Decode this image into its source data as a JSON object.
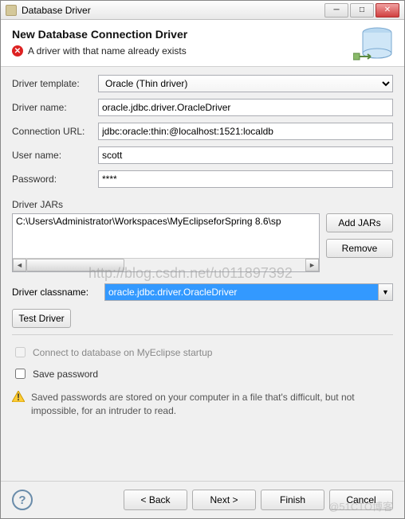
{
  "window": {
    "title": "Database Driver"
  },
  "header": {
    "title": "New Database Connection Driver",
    "error_message": "A driver with that name already exists"
  },
  "form": {
    "template_label": "Driver template:",
    "template_value": "Oracle (Thin driver)",
    "name_label": "Driver name:",
    "name_value": "oracle.jdbc.driver.OracleDriver",
    "url_label": "Connection URL:",
    "url_value": "jdbc:oracle:thin:@localhost:1521:localdb",
    "user_label": "User name:",
    "user_value": "scott",
    "password_label": "Password:",
    "password_value": "****"
  },
  "jars": {
    "section_label": "Driver JARs",
    "items": [
      "C:\\Users\\Administrator\\Workspaces\\MyEclipseforSpring 8.6\\sp"
    ],
    "add_label": "Add JARs",
    "remove_label": "Remove"
  },
  "classname": {
    "label": "Driver classname:",
    "value": "oracle.jdbc.driver.OracleDriver"
  },
  "test_driver_label": "Test Driver",
  "options": {
    "connect_startup": "Connect to database on MyEclipse startup",
    "save_password": "Save password",
    "password_warning": "Saved passwords are stored on your computer in a file that's difficult, but not impossible, for an intruder to read."
  },
  "footer": {
    "back": "< Back",
    "next": "Next >",
    "finish": "Finish",
    "cancel": "Cancel"
  },
  "watermark1": "http://blog.csdn.net/u011897392",
  "watermark2": "@51CTO博客"
}
